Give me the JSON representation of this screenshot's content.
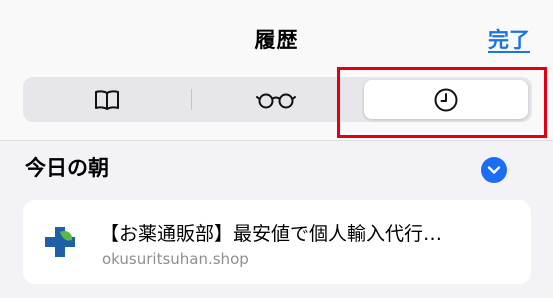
{
  "header": {
    "title": "履歴",
    "done_label": "完了"
  },
  "segments": [
    {
      "name": "bookmarks",
      "icon": "book-icon",
      "selected": false
    },
    {
      "name": "reading-list",
      "icon": "glasses-icon",
      "selected": false
    },
    {
      "name": "history",
      "icon": "clock-icon",
      "selected": true
    }
  ],
  "section": {
    "title": "今日の朝",
    "toggle_icon": "chevron-down-circle-icon"
  },
  "history_items": [
    {
      "title": "【お薬通販部】最安値で個人輸入代行…",
      "url": "okusuritsuhan.shop",
      "favicon": "medical-cross-icon"
    }
  ],
  "colors": {
    "accent": "#1a73e8",
    "highlight": "#e10010"
  }
}
